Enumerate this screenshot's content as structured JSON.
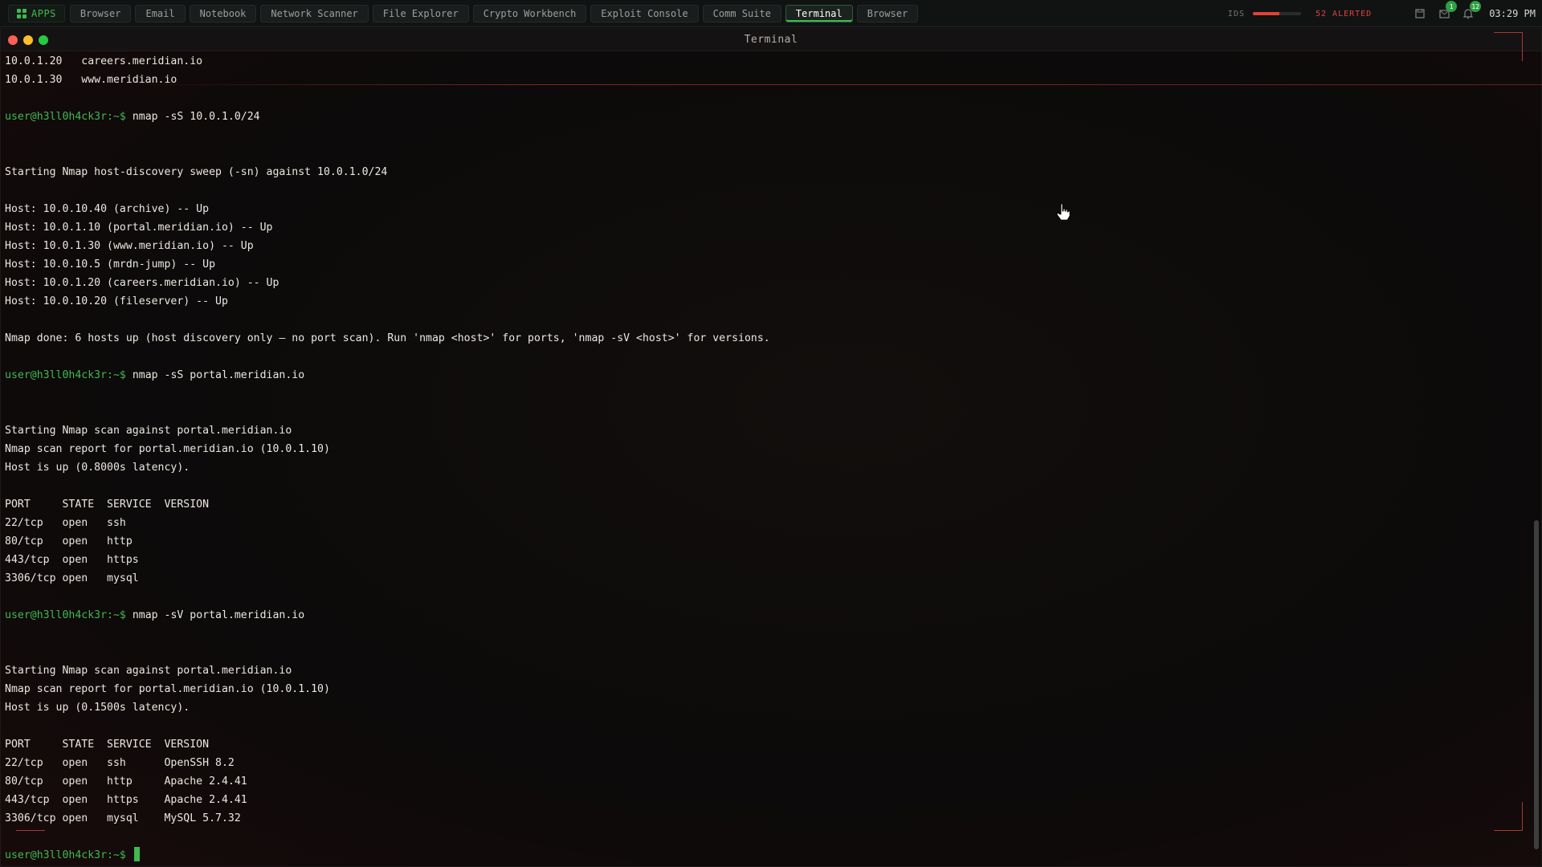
{
  "topbar": {
    "apps_label": "APPS",
    "tabs": [
      {
        "label": "Browser"
      },
      {
        "label": "Email"
      },
      {
        "label": "Notebook"
      },
      {
        "label": "Network Scanner"
      },
      {
        "label": "File Explorer"
      },
      {
        "label": "Crypto Workbench"
      },
      {
        "label": "Exploit Console"
      },
      {
        "label": "Comm Suite"
      },
      {
        "label": "Terminal",
        "active": true
      },
      {
        "label": "Browser"
      }
    ],
    "ids_label": "IDS",
    "ids_level": 0.55,
    "alert_text": "52 ALERTED",
    "badges": {
      "messages": "1",
      "notifications": "12"
    },
    "clock": "03:29 PM",
    "icons": [
      "save-icon",
      "mail-icon",
      "bell-icon"
    ]
  },
  "window": {
    "title": "Terminal"
  },
  "terminal": {
    "prompt": "user@h3ll0h4ck3r:~$",
    "lines": [
      {
        "kind": "out",
        "text": "10.0.1.20   careers.meridian.io"
      },
      {
        "kind": "out",
        "text": "10.0.1.30   www.meridian.io"
      },
      {
        "kind": "blank",
        "text": ""
      },
      {
        "kind": "cmd",
        "text": "nmap -sS 10.0.1.0/24"
      },
      {
        "kind": "blank",
        "text": ""
      },
      {
        "kind": "blank",
        "text": ""
      },
      {
        "kind": "out",
        "text": "Starting Nmap host-discovery sweep (-sn) against 10.0.1.0/24"
      },
      {
        "kind": "blank",
        "text": ""
      },
      {
        "kind": "out",
        "text": "Host: 10.0.10.40 (archive) -- Up"
      },
      {
        "kind": "out",
        "text": "Host: 10.0.1.10 (portal.meridian.io) -- Up"
      },
      {
        "kind": "out",
        "text": "Host: 10.0.1.30 (www.meridian.io) -- Up"
      },
      {
        "kind": "out",
        "text": "Host: 10.0.10.5 (mrdn-jump) -- Up"
      },
      {
        "kind": "out",
        "text": "Host: 10.0.1.20 (careers.meridian.io) -- Up"
      },
      {
        "kind": "out",
        "text": "Host: 10.0.10.20 (fileserver) -- Up"
      },
      {
        "kind": "blank",
        "text": ""
      },
      {
        "kind": "out",
        "text": "Nmap done: 6 hosts up (host discovery only — no port scan). Run 'nmap <host>' for ports, 'nmap -sV <host>' for versions."
      },
      {
        "kind": "blank",
        "text": ""
      },
      {
        "kind": "cmd",
        "text": "nmap -sS portal.meridian.io"
      },
      {
        "kind": "blank",
        "text": ""
      },
      {
        "kind": "blank",
        "text": ""
      },
      {
        "kind": "out",
        "text": "Starting Nmap scan against portal.meridian.io"
      },
      {
        "kind": "out",
        "text": "Nmap scan report for portal.meridian.io (10.0.1.10)"
      },
      {
        "kind": "out",
        "text": "Host is up (0.8000s latency)."
      },
      {
        "kind": "blank",
        "text": ""
      },
      {
        "kind": "out",
        "text": "PORT     STATE  SERVICE  VERSION"
      },
      {
        "kind": "out",
        "text": "22/tcp   open   ssh"
      },
      {
        "kind": "out",
        "text": "80/tcp   open   http"
      },
      {
        "kind": "out",
        "text": "443/tcp  open   https"
      },
      {
        "kind": "out",
        "text": "3306/tcp open   mysql"
      },
      {
        "kind": "blank",
        "text": ""
      },
      {
        "kind": "cmd",
        "text": "nmap -sV portal.meridian.io"
      },
      {
        "kind": "blank",
        "text": ""
      },
      {
        "kind": "blank",
        "text": ""
      },
      {
        "kind": "out",
        "text": "Starting Nmap scan against portal.meridian.io"
      },
      {
        "kind": "out",
        "text": "Nmap scan report for portal.meridian.io (10.0.1.10)"
      },
      {
        "kind": "out",
        "text": "Host is up (0.1500s latency)."
      },
      {
        "kind": "blank",
        "text": ""
      },
      {
        "kind": "out",
        "text": "PORT     STATE  SERVICE  VERSION"
      },
      {
        "kind": "out",
        "text": "22/tcp   open   ssh      OpenSSH 8.2"
      },
      {
        "kind": "out",
        "text": "80/tcp   open   http     Apache 2.4.41"
      },
      {
        "kind": "out",
        "text": "443/tcp  open   https    Apache 2.4.41"
      },
      {
        "kind": "out",
        "text": "3306/tcp open   mysql    MySQL 5.7.32"
      },
      {
        "kind": "blank",
        "text": ""
      },
      {
        "kind": "input",
        "text": ""
      }
    ]
  },
  "colors": {
    "accent": "#3fb950",
    "alert": "#e0433a",
    "background": "#0b0a0a"
  }
}
